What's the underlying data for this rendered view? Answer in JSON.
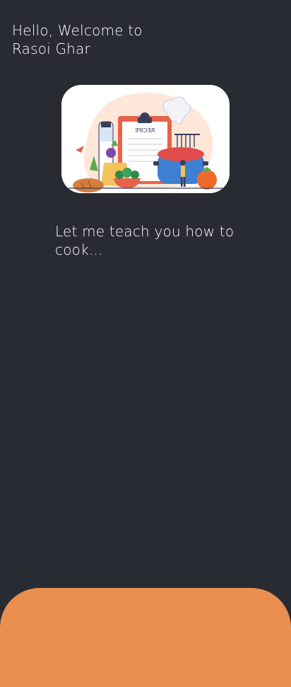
{
  "greeting": {
    "line1": "Hello, Welcome to",
    "line2": "Rasoi Ghar"
  },
  "hero": {
    "recipe_card_label": "RECIPE"
  },
  "tagline": "Let me teach you how to cook...",
  "colors": {
    "background": "#292b33",
    "panel": "#e88f4f",
    "text": "#ffffff"
  }
}
